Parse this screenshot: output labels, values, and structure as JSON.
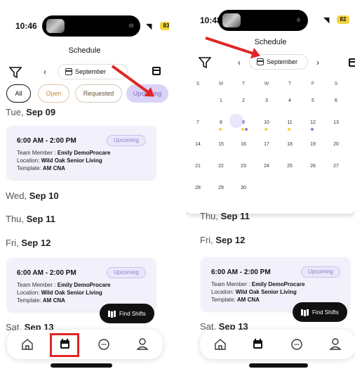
{
  "left": {
    "status": {
      "time": "10:46",
      "battery": "83"
    },
    "header": {
      "title": "Schedule",
      "month": "September"
    },
    "filters": [
      {
        "label": "All",
        "style": "all"
      },
      {
        "label": "Open",
        "style": "open"
      },
      {
        "label": "Requested",
        "style": "req"
      },
      {
        "label": "Upcoming",
        "style": "upc"
      }
    ],
    "days": {
      "d1": {
        "weekday": "Tue, ",
        "date": "Sep 09"
      },
      "d2": {
        "weekday": "Wed, ",
        "date": "Sep 10"
      },
      "d3": {
        "weekday": "Thu, ",
        "date": "Sep 11"
      },
      "d4": {
        "weekday": "Fri, ",
        "date": "Sep 12"
      },
      "d5": {
        "weekday": "Sat, ",
        "date": "Sep 13"
      }
    },
    "shift": {
      "time": "6:00 AM - 2:00 PM",
      "badge": "Upcoming",
      "member_label": "Team Member : ",
      "member": "Emily DemoProcare",
      "location_label": "Location: ",
      "location": "Wild Oak Senior Living",
      "template_label": "Template: ",
      "template": "AM CNA"
    },
    "find_shifts": "Find Shifts"
  },
  "right": {
    "status": {
      "time": "10:48",
      "battery": "82"
    },
    "header": {
      "title": "Schedule",
      "month": "September"
    },
    "calendar": {
      "weekdays": [
        "S",
        "M",
        "T",
        "W",
        "T",
        "F",
        "S"
      ],
      "weeks": [
        [
          "",
          "1",
          "2",
          "3",
          "4",
          "5",
          "6"
        ],
        [
          "7",
          "8",
          "9",
          "10",
          "11",
          "12",
          "13"
        ],
        [
          "14",
          "15",
          "16",
          "17",
          "18",
          "19",
          "20"
        ],
        [
          "21",
          "22",
          "23",
          "24",
          "25",
          "26",
          "27"
        ],
        [
          "28",
          "29",
          "30",
          "",
          "",
          "",
          ""
        ]
      ],
      "selected": "9"
    },
    "days": {
      "d3": {
        "weekday": "Thu, ",
        "date": "Sep 11"
      },
      "d4": {
        "weekday": "Fri, ",
        "date": "Sep 12"
      },
      "d5": {
        "weekday": "Sat, ",
        "date": "Sep 13"
      }
    },
    "shift": {
      "time": "6:00 AM - 2:00 PM",
      "badge": "Upcoming",
      "member_label": "Team Member : ",
      "member": "Emily DemoProcare",
      "location_label": "Location: ",
      "location": "Wild Oak Senior Living",
      "template_label": "Template: ",
      "template": "AM CNA"
    },
    "find_shifts": "Find Shifts"
  },
  "colors": {
    "accent": "#d9d3f8",
    "annotation": "#e02626",
    "dot_yellow": "#f2d33c",
    "dot_purple": "#8b7dca"
  },
  "icons": [
    "filter-icon",
    "calendar-icon",
    "chevron-left-icon",
    "chevron-right-icon",
    "home-icon",
    "calendar-tab-icon",
    "chat-icon",
    "profile-icon",
    "map-icon"
  ]
}
